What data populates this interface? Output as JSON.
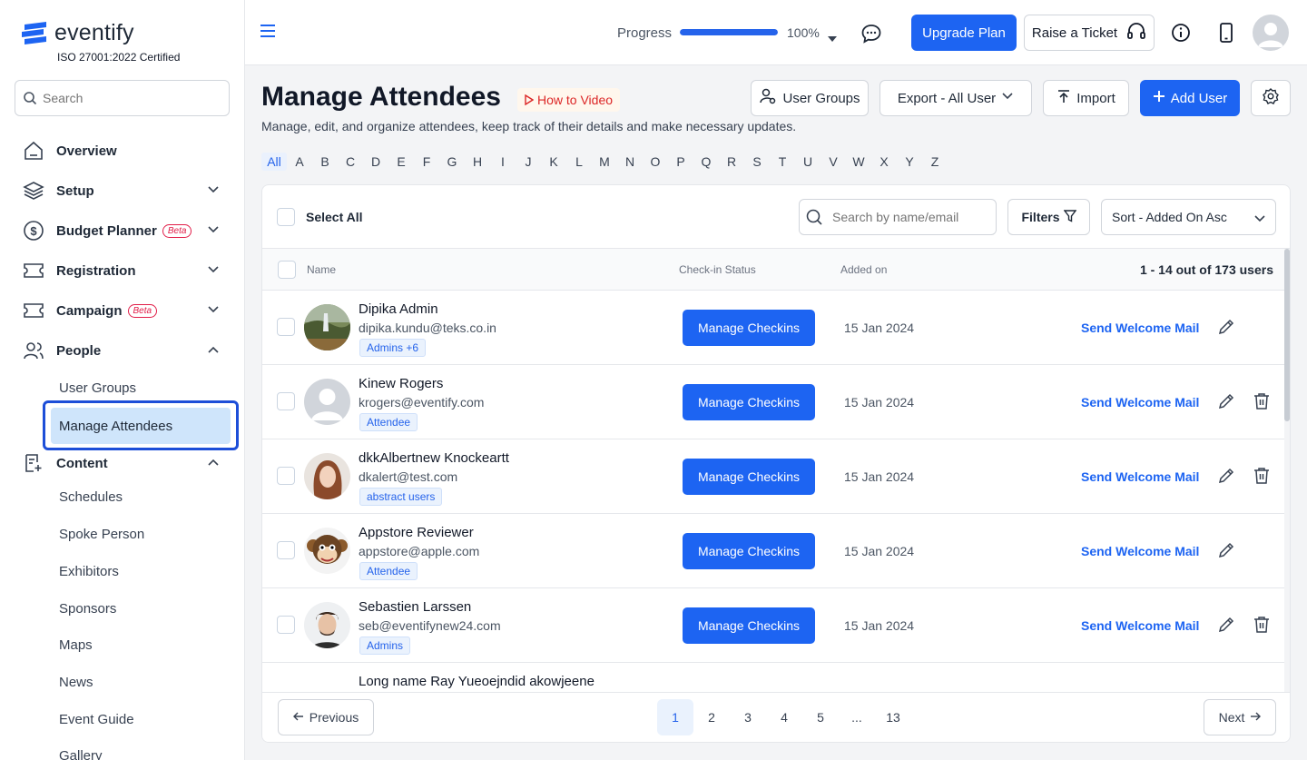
{
  "brand": {
    "name": "eventify",
    "cert": "ISO 27001:2022 Certified"
  },
  "sidebar": {
    "search_placeholder": "Search",
    "items": [
      {
        "label": "Overview"
      },
      {
        "label": "Setup"
      },
      {
        "label": "Budget Planner",
        "badge": "Beta"
      },
      {
        "label": "Registration"
      },
      {
        "label": "Campaign",
        "badge": "Beta"
      },
      {
        "label": "People"
      },
      {
        "label": "Content"
      }
    ],
    "people_sub": [
      "User Groups",
      "Manage Attendees"
    ],
    "content_sub": [
      "Schedules",
      "Spoke Person",
      "Exhibitors",
      "Sponsors",
      "Maps",
      "News",
      "Event Guide",
      "Gallery"
    ]
  },
  "topbar": {
    "progress_label": "Progress",
    "progress_value": 100,
    "progress_text": "100%",
    "upgrade": "Upgrade Plan",
    "ticket": "Raise a Ticket"
  },
  "page": {
    "title": "Manage Attendees",
    "howto": "How to Video",
    "subtitle": "Manage, edit, and organize attendees, keep track of their details and make necessary updates.",
    "buttons": {
      "user_groups": "User Groups",
      "export": "Export - All User",
      "import": "Import",
      "add_user": "Add User"
    }
  },
  "alphabet": [
    "All",
    "A",
    "B",
    "C",
    "D",
    "E",
    "F",
    "G",
    "H",
    "I",
    "J",
    "K",
    "L",
    "M",
    "N",
    "O",
    "P",
    "Q",
    "R",
    "S",
    "T",
    "U",
    "V",
    "W",
    "X",
    "Y",
    "Z"
  ],
  "table": {
    "select_all": "Select All",
    "search_placeholder": "Search by name/email",
    "filters": "Filters",
    "sort": "Sort - Added On Asc",
    "headers": {
      "name": "Name",
      "checkin": "Check-in Status",
      "added": "Added on"
    },
    "count": "1 - 14 out of 173 users",
    "action_label": "Manage Checkins",
    "welcome_label": "Send Welcome Mail",
    "rows": [
      {
        "name": "Dipika Admin",
        "email": "dipika.kundu@teks.co.in",
        "tag": "Admins +6",
        "date": "15 Jan 2024"
      },
      {
        "name": "Kinew Rogers",
        "email": "krogers@eventify.com",
        "tag": "Attendee",
        "date": "15 Jan 2024"
      },
      {
        "name": "dkkAlbertnew Knockeartt",
        "email": "dkalert@test.com",
        "tag": "abstract users",
        "date": "15 Jan 2024"
      },
      {
        "name": "Appstore Reviewer",
        "email": "appstore@apple.com",
        "tag": "Attendee",
        "date": "15 Jan 2024"
      },
      {
        "name": "Sebastien Larssen",
        "email": "seb@eventifynew24.com",
        "tag": "Admins",
        "date": "15 Jan 2024"
      },
      {
        "name": "Long name Ray Yueoejndid akowjeene",
        "email": "",
        "tag": "",
        "date": ""
      }
    ]
  },
  "pagination": {
    "prev": "Previous",
    "next": "Next",
    "pages": [
      "1",
      "2",
      "3",
      "4",
      "5",
      "...",
      "13"
    ],
    "current": "1"
  }
}
